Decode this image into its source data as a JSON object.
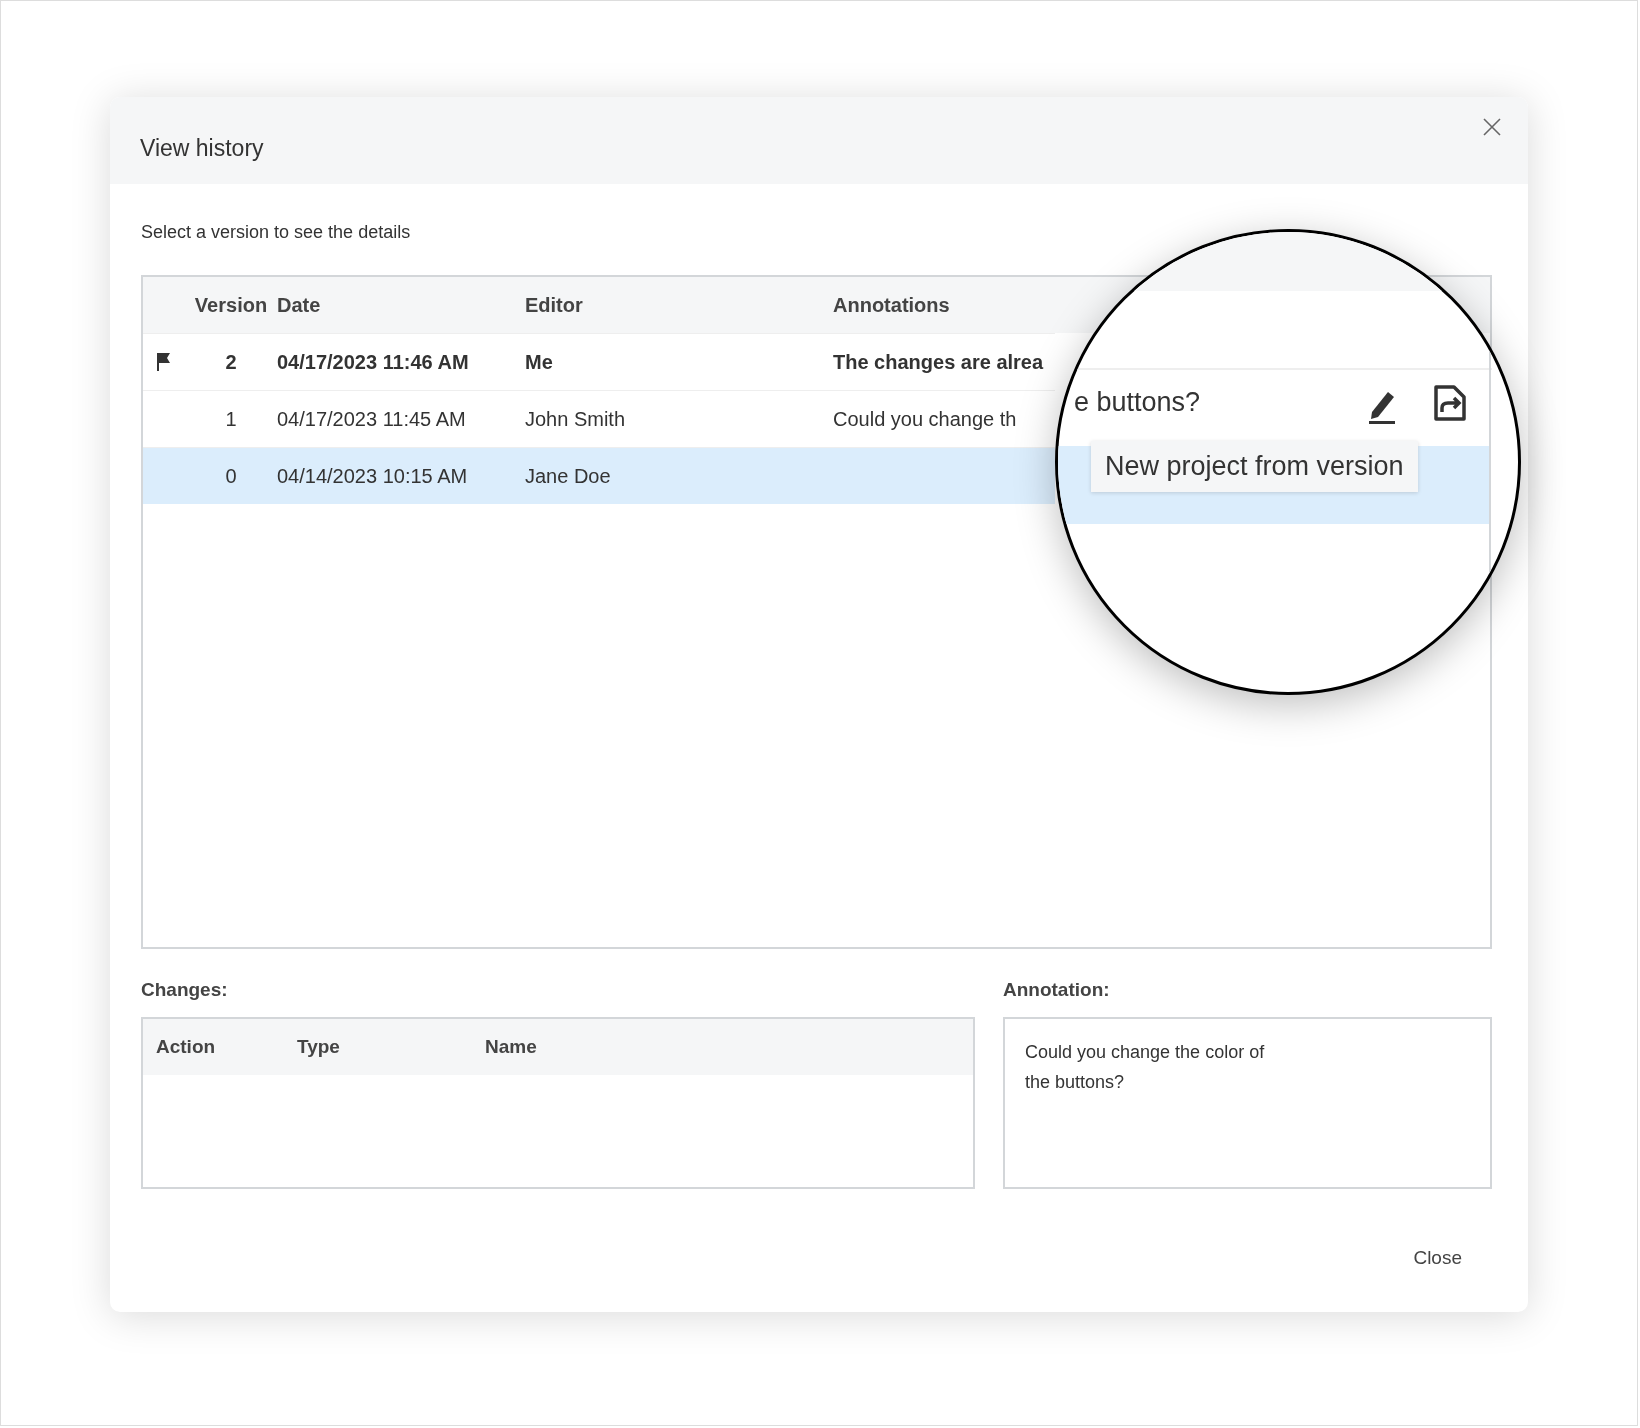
{
  "dialog": {
    "title": "View history",
    "subtitle": "Select a version to see the details",
    "table": {
      "columns": [
        "Version",
        "Date",
        "Editor",
        "Annotations"
      ],
      "rows": [
        {
          "version": "2",
          "date": "04/17/2023 11:46 AM",
          "editor": "Me",
          "annotation": "The changes are alrea",
          "flagged": true,
          "bold": true,
          "selected": false
        },
        {
          "version": "1",
          "date": "04/17/2023 11:45 AM",
          "editor": "John Smith",
          "annotation": "Could you change th",
          "flagged": false,
          "bold": false,
          "selected": false
        },
        {
          "version": "0",
          "date": "04/14/2023 10:15 AM",
          "editor": "Jane Doe",
          "annotation": "",
          "flagged": false,
          "bold": false,
          "selected": true
        }
      ]
    },
    "changes": {
      "label": "Changes:",
      "columns": [
        "Action",
        "Type",
        "Name"
      ]
    },
    "annotation": {
      "label": "Annotation:",
      "value": "Could you change the color of the buttons?"
    },
    "close_button": "Close"
  },
  "magnifier": {
    "annotation_fragment": "e buttons?",
    "tooltip": "New project from version"
  }
}
